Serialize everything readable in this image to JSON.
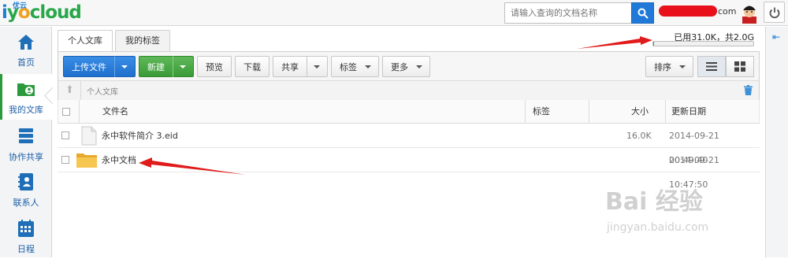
{
  "brand": {
    "logo_small": "优云",
    "logo_text": "iyocloud"
  },
  "search": {
    "placeholder": "请输入查询的文档名称"
  },
  "user": {
    "email_suffix": "com"
  },
  "nav": [
    {
      "label": "首页",
      "icon": "home-icon"
    },
    {
      "label": "我的文库",
      "icon": "folder-user-icon"
    },
    {
      "label": "协作共享",
      "icon": "server-share-icon"
    },
    {
      "label": "联系人",
      "icon": "contacts-icon"
    },
    {
      "label": "日程",
      "icon": "calendar-icon"
    }
  ],
  "tabs": [
    {
      "label": "个人文库"
    },
    {
      "label": "我的标签"
    }
  ],
  "quota": {
    "text": "已用31.0K，共2.0G",
    "used_fraction": 0.01
  },
  "toolbar": {
    "upload": "上传文件",
    "new": "新建",
    "preview": "预览",
    "download": "下载",
    "share": "共享",
    "tags": "标签",
    "more": "更多",
    "sort": "排序"
  },
  "breadcrumb": {
    "path": "个人文库"
  },
  "table": {
    "headers": {
      "name": "文件名",
      "tags": "标签",
      "size": "大小",
      "updated": "更新日期"
    },
    "rows": [
      {
        "name": "永中软件简介 3.eid",
        "type": "file",
        "tags": "",
        "size": "16.0K",
        "updated": "2014-09-21 00:49:40"
      },
      {
        "name": "永中文档",
        "type": "folder",
        "tags": "",
        "size": "",
        "updated": "2014-09-21 10:47:50"
      }
    ]
  },
  "watermark": {
    "line1": "Bai 经验",
    "line2": "jingyan.baidu.com"
  },
  "colors": {
    "accent_blue": "#2079d8",
    "accent_green": "#3b9a37",
    "annotation_red": "#e01b1b"
  }
}
